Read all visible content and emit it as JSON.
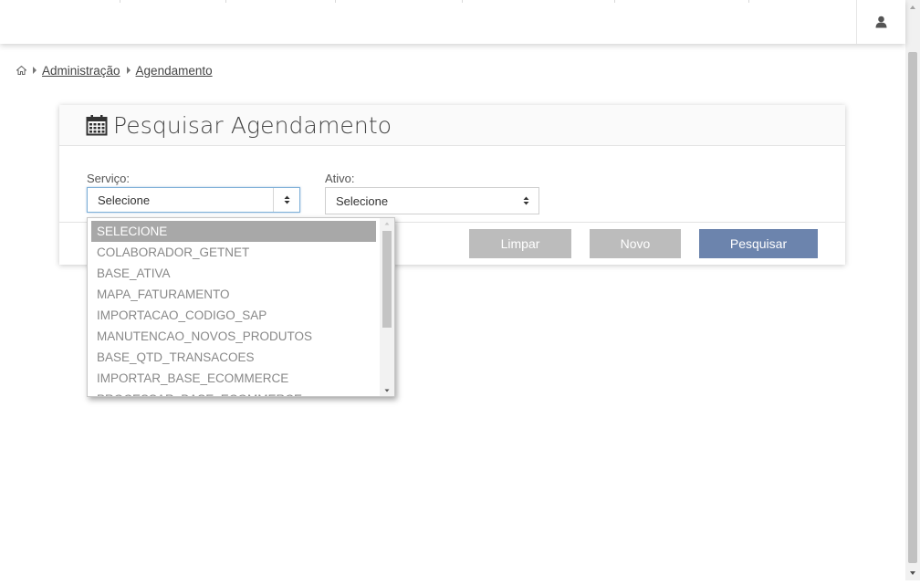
{
  "breadcrumb": {
    "home_icon": "home-icon",
    "items": [
      "Administração",
      "Agendamento"
    ]
  },
  "panel": {
    "icon": "calendar-icon",
    "title": "Pesquisar Agendamento"
  },
  "filters": {
    "servico": {
      "label": "Serviço:",
      "value": "Selecione"
    },
    "ativo": {
      "label": "Ativo:",
      "value": "Selecione"
    }
  },
  "buttons": {
    "limpar": "Limpar",
    "novo": "Novo",
    "pesquisar": "Pesquisar"
  },
  "dropdown": {
    "selected_index": 0,
    "options": [
      "SELECIONE",
      "COLABORADOR_GETNET",
      "BASE_ATIVA",
      "MAPA_FATURAMENTO",
      "IMPORTACAO_CODIGO_SAP",
      "MANUTENCAO_NOVOS_PRODUTOS",
      "BASE_QTD_TRANSACOES",
      "IMPORTAR_BASE_ECOMMERCE",
      "PROCESSAR_BASE_ECOMMERCE"
    ]
  },
  "colors": {
    "primary_button": "#6c84ad",
    "secondary_button": "#bcbcbc",
    "focus_border": "#7fb0d8"
  },
  "navbar": {
    "user_icon": "user-icon"
  }
}
